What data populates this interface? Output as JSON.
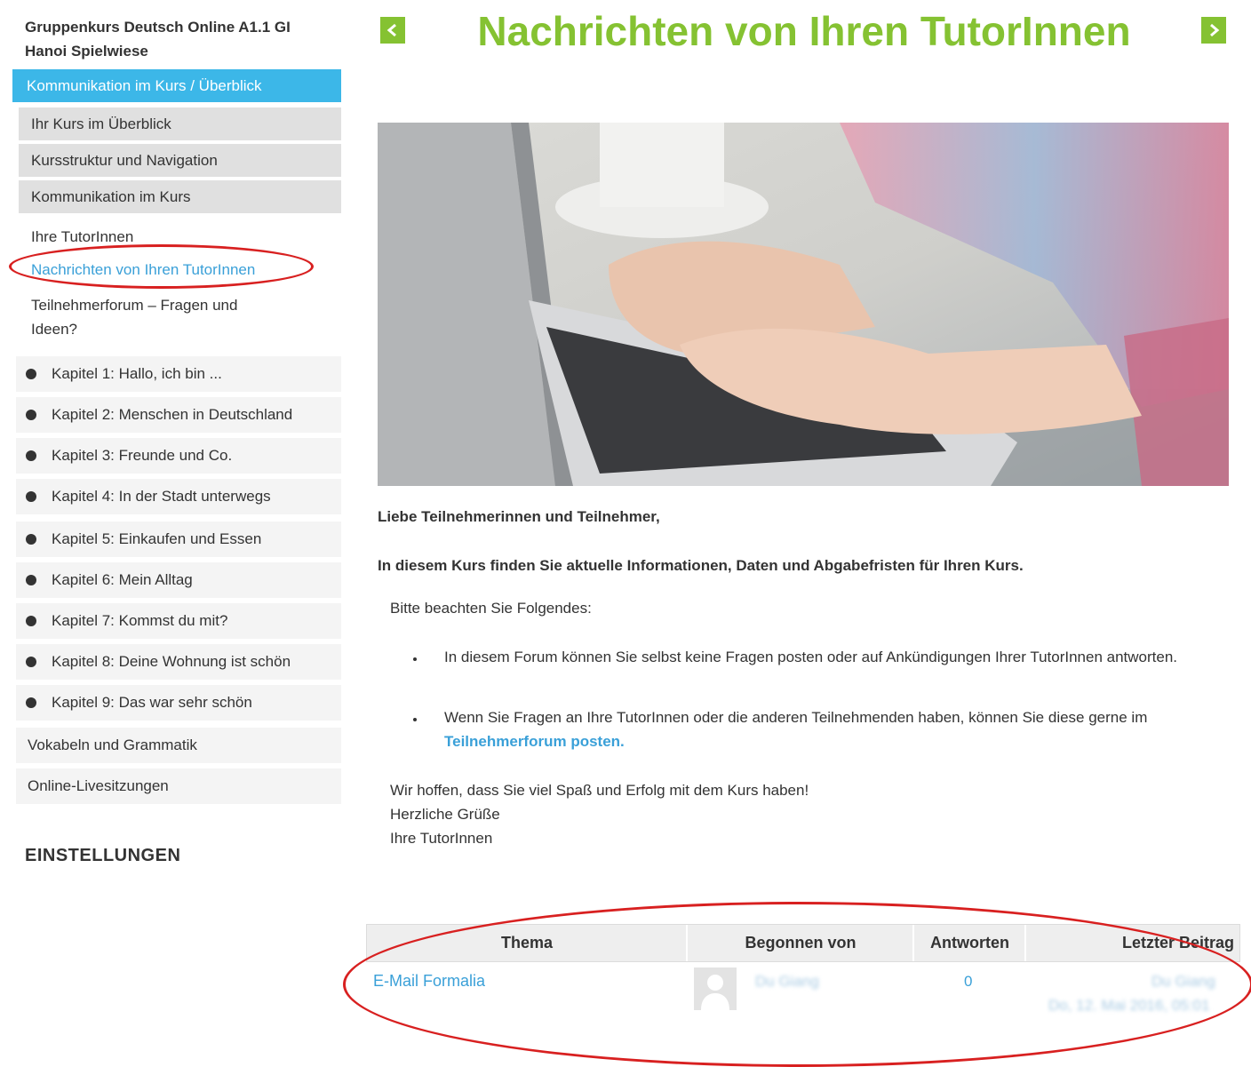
{
  "course": {
    "title": "Gruppenkurs Deutsch Online A1.1 GI Hanoi Spielwiese"
  },
  "sidebar": {
    "active_section": "Kommunikation im Kurs / Überblick",
    "sub_items": [
      "Ihr Kurs im Überblick",
      "Kursstruktur und Navigation",
      "Kommunikation im Kurs"
    ],
    "links": [
      "Ihre TutorInnen",
      "Nachrichten von Ihren TutorInnen",
      "Teilnehmerforum – Fragen und Ideen?"
    ],
    "chapters": [
      "Kapitel 1: Hallo, ich bin ...",
      "Kapitel 2: Menschen in Deutschland",
      "Kapitel 3: Freunde und Co.",
      "Kapitel 4: In der Stadt unterwegs",
      "Kapitel 5: Einkaufen und Essen",
      "Kapitel 6: Mein Alltag",
      "Kapitel 7: Kommst du mit?",
      "Kapitel 8: Deine Wohnung ist schön",
      "Kapitel 9: Das war sehr schön"
    ],
    "extra_items": [
      "Vokabeln und Grammatik",
      "Online-Livesitzungen"
    ],
    "settings_heading": "EINSTELLUNGEN"
  },
  "page": {
    "title": "Nachrichten von Ihren TutorInnen",
    "greeting": "Liebe Teilnehmerinnen und Teilnehmer,",
    "intro": "In diesem Kurs finden Sie aktuelle Informationen, Daten und Abgabefristen für Ihren Kurs.",
    "notice": "Bitte beachten Sie Folgendes:",
    "bullets": [
      "In diesem Forum können Sie selbst keine Fragen posten oder auf Ankündigungen Ihrer TutorInnen antworten.",
      "Wenn Sie Fragen an Ihre TutorInnen oder die anderen Teilnehmenden haben, können Sie diese gerne im "
    ],
    "bullet2_link": "Teilnehmerforum posten",
    "bullet2_end": ".",
    "closing": [
      "Wir hoffen, dass Sie viel Spaß und Erfolg mit dem Kurs haben!",
      "Herzliche Grüße",
      "Ihre TutorInnen"
    ]
  },
  "forum_table": {
    "headers": [
      "Thema",
      "Begonnen von",
      "Antworten",
      "Letzter Beitrag"
    ],
    "rows": [
      {
        "topic": "E-Mail Formalia",
        "started_by": "Du Giang",
        "replies": "0",
        "last_post_author": "Du Giang",
        "last_post_date": "Do, 12. Mai 2016, 05:01"
      }
    ]
  },
  "colors": {
    "accent_green": "#85c232",
    "accent_blue": "#3cb7e8",
    "link_blue": "#3aa0d8",
    "annotation_red": "#d82020"
  },
  "icons": {
    "prev": "chevron-left-icon",
    "next": "chevron-right-icon",
    "bullet": "bullet-icon",
    "avatar": "user-avatar-icon"
  }
}
